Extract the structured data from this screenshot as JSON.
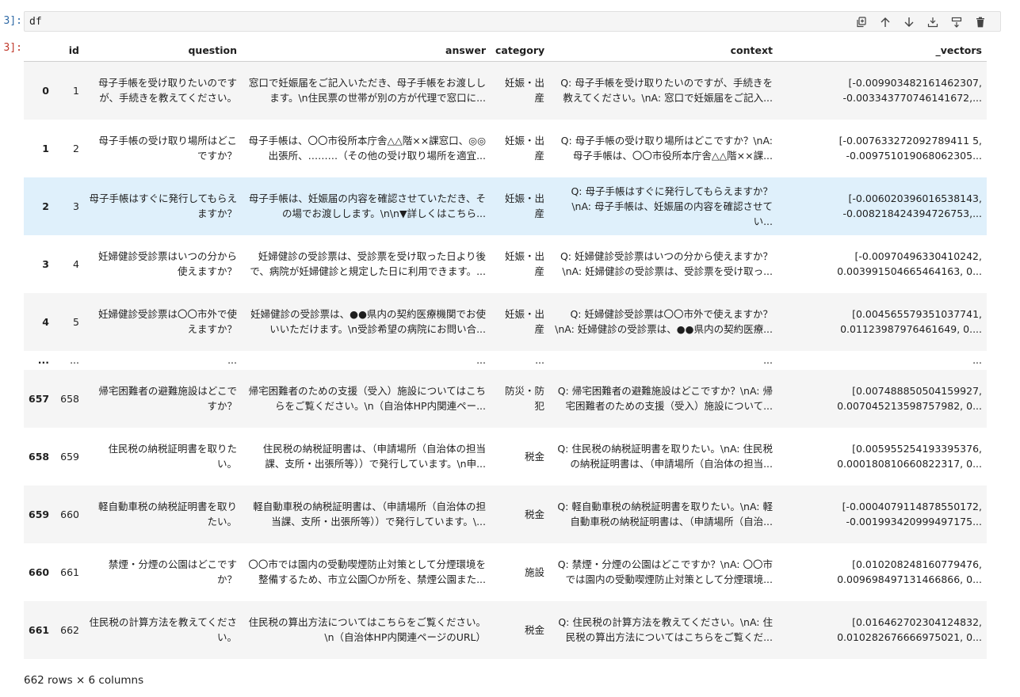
{
  "cell": {
    "input_prompt": "3]:",
    "output_prompt": "3]:",
    "code": "df"
  },
  "toolbar": [
    {
      "name": "duplicate-cell-button",
      "icon": "copy-icon"
    },
    {
      "name": "move-up-button",
      "icon": "arrow-up-icon"
    },
    {
      "name": "move-down-button",
      "icon": "arrow-down-icon"
    },
    {
      "name": "insert-above-button",
      "icon": "insert-above-icon"
    },
    {
      "name": "insert-below-button",
      "icon": "insert-below-icon"
    },
    {
      "name": "delete-cell-button",
      "icon": "trash-icon"
    }
  ],
  "table": {
    "columns": [
      "",
      "id",
      "question",
      "answer",
      "category",
      "context",
      "_vectors"
    ],
    "rows": [
      [
        "0",
        "1",
        "母子手帳を受け取りたいのですが、手続きを教えてください。",
        "窓口で妊娠届をご記入いただき、母子手帳をお渡しします。\\n住民票の世帯が別の方が代理で窓口に...",
        "妊娠・出産",
        "Q: 母子手帳を受け取りたいのですが、手続きを教えてください。\\nA: 窓口で妊娠届をご記入...",
        "[-0.009903482161462307, -0.003343770746141672,..."
      ],
      [
        "1",
        "2",
        "母子手帳の受け取り場所はどこですか？",
        "母子手帳は、〇〇市役所本庁舎△△階××課窓口、◎◎出張所、………（その他の受け取り場所を適宜...",
        "妊娠・出産",
        "Q: 母子手帳の受け取り場所はどこですか？\\nA: 母子手帳は、〇〇市役所本庁舎△△階××課...",
        "[-0.007633272092789411 5, -0.009751019068062305..."
      ],
      [
        "2",
        "3",
        "母子手帳はすぐに発行してもらえますか？",
        "母子手帳は、妊娠届の内容を確認させていただき、その場でお渡しします。\\n\\n▼詳しくはこちら...",
        "妊娠・出産",
        "Q: 母子手帳はすぐに発行してもらえますか？\\nA: 母子手帳は、妊娠届の内容を確認させてい...",
        "[-0.006020396016538143, -0.008218424394726753,..."
      ],
      [
        "3",
        "4",
        "妊婦健診受診票はいつの分から使えますか？",
        "妊婦健診の受診票は、受診票を受け取った日より後で、病院が妊婦健診と規定した日に利用できます。...",
        "妊娠・出産",
        "Q: 妊婦健診受診票はいつの分から使えますか？\\nA: 妊婦健診の受診票は、受診票を受け取っ...",
        "[-0.00970496330410242, 0.003991504665464163, 0..."
      ],
      [
        "4",
        "5",
        "妊婦健診受診票は〇〇市外で使えますか？",
        "妊婦健診の受診票は、●●県内の契約医療機関でお使いいただけます。\\n受診希望の病院にお問い合...",
        "妊娠・出産",
        "Q: 妊婦健診受診票は〇〇市外で使えますか？\\nA: 妊婦健診の受診票は、●●県内の契約医療...",
        "[0.004565579351037741, 0.01123987976461649, 0...."
      ],
      [
        "...",
        "...",
        "...",
        "...",
        "...",
        "...",
        "..."
      ],
      [
        "657",
        "658",
        "帰宅困難者の避難施設はどこですか？",
        "帰宅困難者のための支援（受入）施設についてはこちらをご覧ください。\\n（自治体HP内関連ペー...",
        "防災・防犯",
        "Q: 帰宅困難者の避難施設はどこですか？\\nA: 帰宅困難者のための支援（受入）施設について...",
        "[0.007488850504159927, 0.007045213598757982, 0..."
      ],
      [
        "658",
        "659",
        "住民税の納税証明書を取りたい。",
        "住民税の納税証明書は、（申請場所（自治体の担当課、支所・出張所等））で発行しています。\\n申...",
        "税金",
        "Q: 住民税の納税証明書を取りたい。\\nA: 住民税の納税証明書は、（申請場所（自治体の担当...",
        "[0.005955254193395376, 0.000180810660822317, 0..."
      ],
      [
        "659",
        "660",
        "軽自動車税の納税証明書を取りたい。",
        "軽自動車税の納税証明書は、（申請場所（自治体の担当課、支所・出張所等））で発行しています。\\...",
        "税金",
        "Q: 軽自動車税の納税証明書を取りたい。\\nA: 軽自動車税の納税証明書は、（申請場所（自治...",
        "[-0.0004079114878550172, -0.001993420999497175..."
      ],
      [
        "660",
        "661",
        "禁煙・分煙の公園はどこですか？",
        "〇〇市では園内の受動喫煙防止対策として分煙環境を整備するため、市立公園〇か所を、禁煙公園また...",
        "施設",
        "Q: 禁煙・分煙の公園はどこですか？\\nA: 〇〇市では園内の受動喫煙防止対策として分煙環境...",
        "[0.010208248160779476, 0.009698497131466866, 0..."
      ],
      [
        "661",
        "662",
        "住民税の計算方法を教えてください。",
        "住民税の算出方法についてはこちらをご覧ください。\\n（自治体HP内関連ページのURL）",
        "税金",
        "Q: 住民税の計算方法を教えてください。\\nA: 住民税の算出方法についてはこちらをご覧くだ...",
        "[0.016462702304124832, 0.010282676666975021, 0..."
      ]
    ]
  },
  "summary": "662 rows × 6 columns"
}
